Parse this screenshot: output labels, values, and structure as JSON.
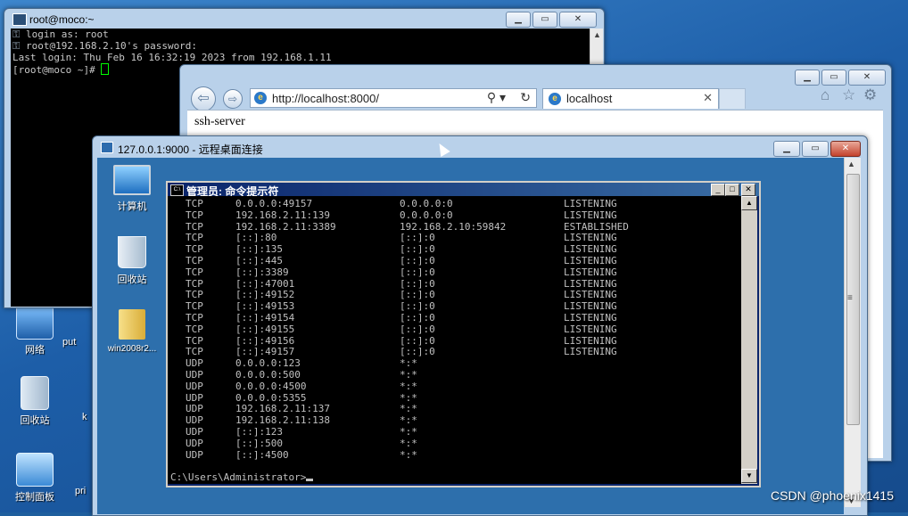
{
  "host_desktop": {
    "icons": [
      {
        "label": "网络",
        "icon": "network-icon"
      },
      {
        "label": "回收站",
        "icon": "recycle-bin-icon"
      },
      {
        "label": "控制面板",
        "icon": "control-panel-icon"
      }
    ],
    "partial_labels": [
      "put",
      "k",
      "pri"
    ]
  },
  "putty": {
    "title": "root@moco:~",
    "lines": [
      "login as: root",
      "root@192.168.2.10's password:",
      "Last login: Thu Feb 16 16:32:19 2023 from 192.168.1.11"
    ],
    "prompt": "[root@moco ~]# "
  },
  "ie": {
    "url": "http://localhost:8000/",
    "tab_label": "localhost",
    "page_text": "ssh-server"
  },
  "rdp": {
    "title": "127.0.0.1:9000 - 远程桌面连接",
    "desktop_icons": [
      {
        "label": "计算机",
        "icon": "computer-icon"
      },
      {
        "label": "回收站",
        "icon": "recycle-bin-icon"
      },
      {
        "label": "win2008r2...",
        "icon": "folder-icon"
      }
    ]
  },
  "cmd": {
    "title": "管理员: 命令提示符",
    "rows": [
      [
        "TCP",
        "0.0.0.0:49157",
        "0.0.0.0:0",
        "LISTENING"
      ],
      [
        "TCP",
        "192.168.2.11:139",
        "0.0.0.0:0",
        "LISTENING"
      ],
      [
        "TCP",
        "192.168.2.11:3389",
        "192.168.2.10:59842",
        "ESTABLISHED"
      ],
      [
        "TCP",
        "[::]:80",
        "[::]:0",
        "LISTENING"
      ],
      [
        "TCP",
        "[::]:135",
        "[::]:0",
        "LISTENING"
      ],
      [
        "TCP",
        "[::]:445",
        "[::]:0",
        "LISTENING"
      ],
      [
        "TCP",
        "[::]:3389",
        "[::]:0",
        "LISTENING"
      ],
      [
        "TCP",
        "[::]:47001",
        "[::]:0",
        "LISTENING"
      ],
      [
        "TCP",
        "[::]:49152",
        "[::]:0",
        "LISTENING"
      ],
      [
        "TCP",
        "[::]:49153",
        "[::]:0",
        "LISTENING"
      ],
      [
        "TCP",
        "[::]:49154",
        "[::]:0",
        "LISTENING"
      ],
      [
        "TCP",
        "[::]:49155",
        "[::]:0",
        "LISTENING"
      ],
      [
        "TCP",
        "[::]:49156",
        "[::]:0",
        "LISTENING"
      ],
      [
        "TCP",
        "[::]:49157",
        "[::]:0",
        "LISTENING"
      ],
      [
        "UDP",
        "0.0.0.0:123",
        "*:*",
        ""
      ],
      [
        "UDP",
        "0.0.0.0:500",
        "*:*",
        ""
      ],
      [
        "UDP",
        "0.0.0.0:4500",
        "*:*",
        ""
      ],
      [
        "UDP",
        "0.0.0.0:5355",
        "*:*",
        ""
      ],
      [
        "UDP",
        "192.168.2.11:137",
        "*:*",
        ""
      ],
      [
        "UDP",
        "192.168.2.11:138",
        "*:*",
        ""
      ],
      [
        "UDP",
        "[::]:123",
        "*:*",
        ""
      ],
      [
        "UDP",
        "[::]:500",
        "*:*",
        ""
      ],
      [
        "UDP",
        "[::]:4500",
        "*:*",
        ""
      ]
    ],
    "prompt": "C:\\Users\\Administrator>"
  },
  "watermark": "CSDN @phoenix1415"
}
